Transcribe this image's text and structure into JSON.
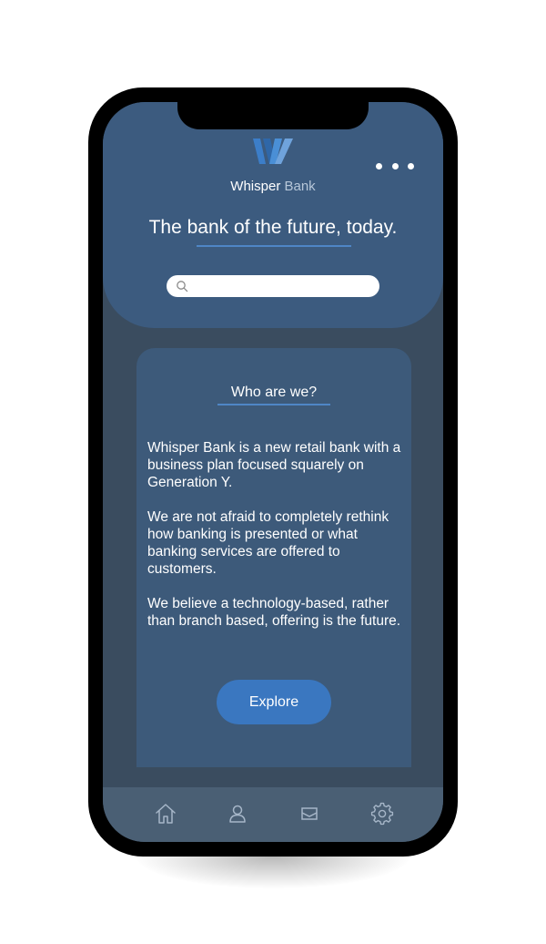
{
  "app": {
    "brand_primary": "Whisper",
    "brand_secondary": "Bank",
    "tagline": "The bank of the future, today."
  },
  "header": {
    "logo_icon": "whisper-bank-w-logo",
    "menu_icon": "more-horizontal-icon"
  },
  "search": {
    "icon": "search-icon",
    "value": "",
    "placeholder": ""
  },
  "card": {
    "title": "Who are we?",
    "paragraphs": [
      "Whisper Bank is a new retail bank with a business plan focused squarely on Generation Y.",
      "We are not afraid to completely rethink how banking is presented or what banking services are offered to customers.",
      "We believe a technology-based, rather than branch based, offering is the future."
    ],
    "button_label": "Explore"
  },
  "navbar": {
    "items": [
      {
        "icon": "home-icon"
      },
      {
        "icon": "user-icon"
      },
      {
        "icon": "mail-icon"
      },
      {
        "icon": "gear-icon"
      }
    ]
  },
  "colors": {
    "header_bg": "#3c5b7f",
    "screen_bg": "#3a4c5f",
    "card_bg": "#3d5a7a",
    "accent": "#3a77c0",
    "underline": "#4f86c6",
    "navbar_bg": "#4a5f74"
  }
}
